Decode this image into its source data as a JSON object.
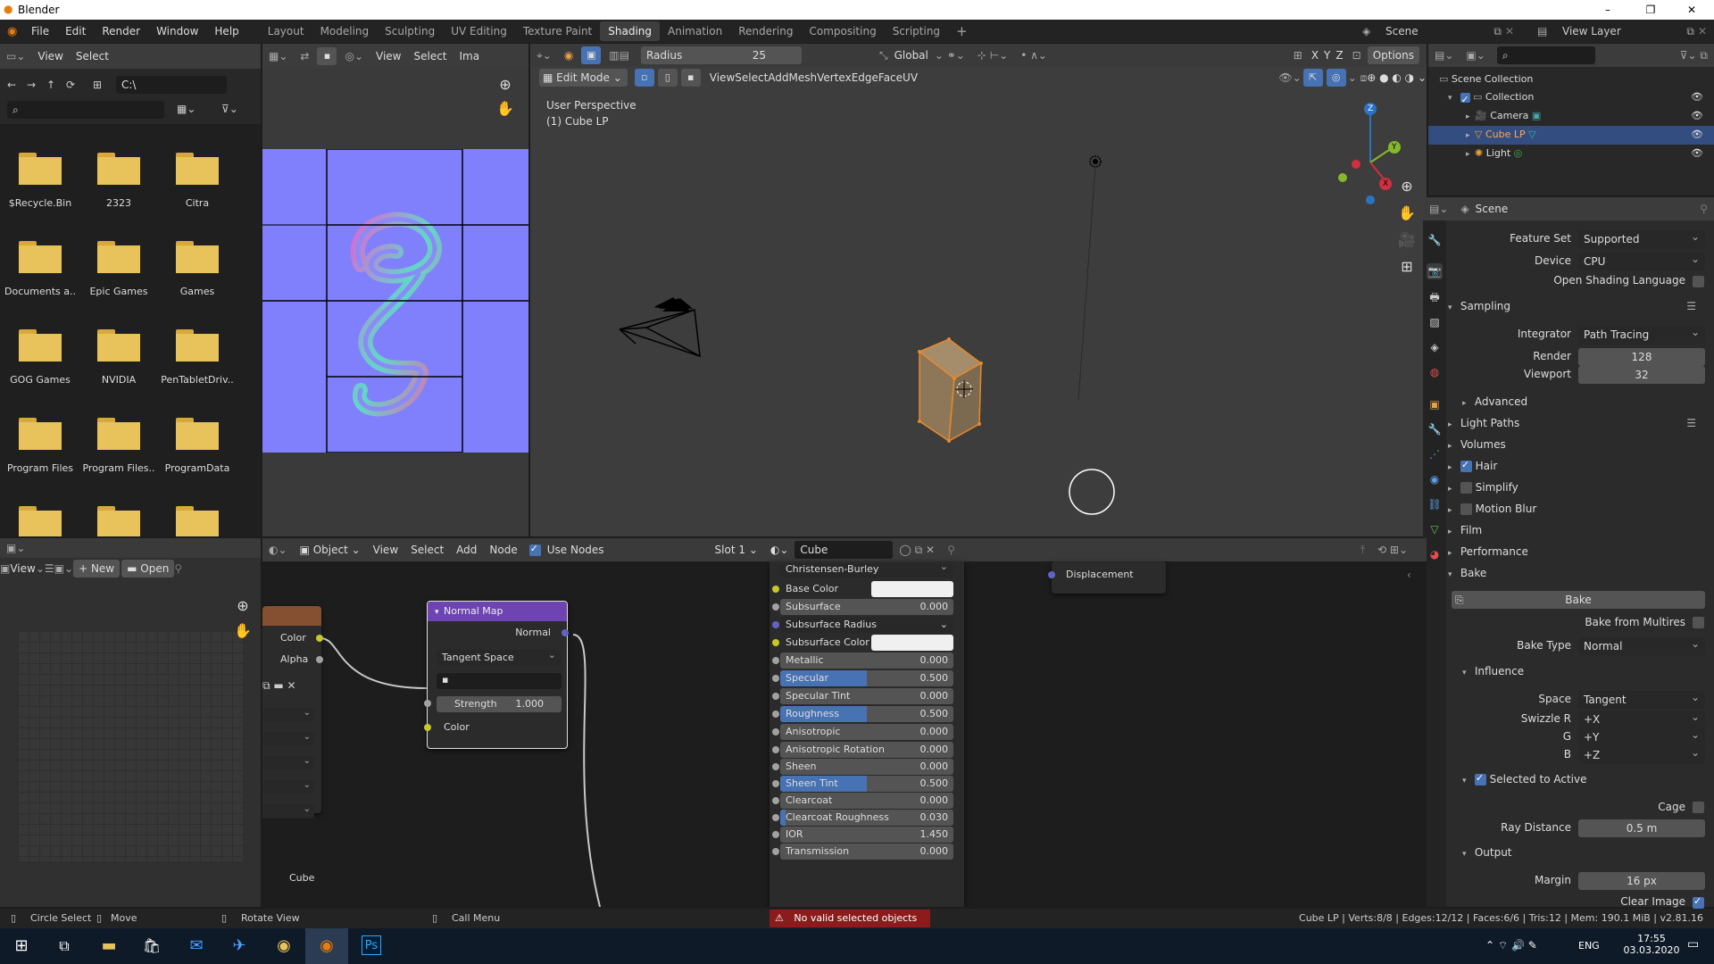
{
  "window": {
    "title": "Blender",
    "controls": {
      "minimize": "–",
      "maximize": "❐",
      "close": "✕"
    }
  },
  "menus": [
    "File",
    "Edit",
    "Render",
    "Window",
    "Help"
  ],
  "workspaces": [
    "Layout",
    "Modeling",
    "Sculpting",
    "UV Editing",
    "Texture Paint",
    "Shading",
    "Animation",
    "Rendering",
    "Compositing",
    "Scripting"
  ],
  "active_workspace": "Shading",
  "scene": {
    "label": "Scene",
    "view_layer": "View Layer"
  },
  "file_browser": {
    "menu": [
      "View",
      "Select"
    ],
    "path": "C:\\",
    "folders": [
      "$Recycle.Bin",
      "2323",
      "Citra",
      "Documents a..",
      "Epic Games",
      "Games",
      "GOG Games",
      "NVIDIA",
      "PenTabletDriv..",
      "Program Files",
      "Program Files..",
      "ProgramData"
    ]
  },
  "uv_editor": {
    "menu": [
      "View",
      "Select",
      "Ima"
    ]
  },
  "viewport": {
    "brush": {
      "label": "Radius",
      "value": "25"
    },
    "orientation": "Global",
    "axes": [
      "X",
      "Y",
      "Z"
    ],
    "options": "Options",
    "mode": "Edit Mode",
    "menu": [
      "View",
      "Select",
      "Add",
      "Mesh",
      "Vertex",
      "Edge",
      "Face",
      "UV"
    ],
    "overlay_title": "User Perspective",
    "overlay_object": "(1) Cube LP",
    "gizmo": {
      "x": "X",
      "y": "Y",
      "z": "Z"
    }
  },
  "outliner": {
    "root": "Scene Collection",
    "collection": "Collection",
    "items": [
      "Camera",
      "Cube LP",
      "Light"
    ]
  },
  "image_editor": {
    "menu": [
      "View"
    ],
    "new": "New",
    "open": "Open"
  },
  "node_editor": {
    "mode": "Object",
    "menu": [
      "View",
      "Select",
      "Add",
      "Node"
    ],
    "use_nodes": "Use Nodes",
    "slot": "Slot 1",
    "material": "Cube",
    "image_node": {
      "outputs": [
        "Color",
        "Alpha"
      ],
      "label": "Cube"
    },
    "normal_map": {
      "title": "Normal Map",
      "output": "Normal",
      "space": "Tangent Space",
      "strength_label": "Strength",
      "strength": "1.000",
      "input": "Color"
    },
    "bsdf_top": "Christensen-Burley",
    "bsdf": [
      {
        "label": "Base Color",
        "type": "color"
      },
      {
        "label": "Subsurface",
        "value": "0.000"
      },
      {
        "label": "Subsurface Radius",
        "type": "dropdown"
      },
      {
        "label": "Subsurface Color",
        "type": "color"
      },
      {
        "label": "Metallic",
        "value": "0.000"
      },
      {
        "label": "Specular",
        "value": "0.500",
        "fill": 0.5
      },
      {
        "label": "Specular Tint",
        "value": "0.000"
      },
      {
        "label": "Roughness",
        "value": "0.500",
        "fill": 0.5
      },
      {
        "label": "Anisotropic",
        "value": "0.000"
      },
      {
        "label": "Anisotropic Rotation",
        "value": "0.000"
      },
      {
        "label": "Sheen",
        "value": "0.000"
      },
      {
        "label": "Sheen Tint",
        "value": "0.500",
        "fill": 0.5
      },
      {
        "label": "Clearcoat",
        "value": "0.000"
      },
      {
        "label": "Clearcoat Roughness",
        "value": "0.030",
        "fill": 0.03
      },
      {
        "label": "IOR",
        "value": "1.450"
      },
      {
        "label": "Transmission",
        "value": "0.000"
      }
    ],
    "output_node": "Displacement"
  },
  "properties": {
    "header": "Scene",
    "feature_set": {
      "label": "Feature Set",
      "value": "Supported"
    },
    "device": {
      "label": "Device",
      "value": "CPU"
    },
    "osl": "Open Shading Language",
    "sampling": "Sampling",
    "integrator": {
      "label": "Integrator",
      "value": "Path Tracing"
    },
    "render": {
      "label": "Render",
      "value": "128"
    },
    "viewport": {
      "label": "Viewport",
      "value": "32"
    },
    "advanced": "Advanced",
    "panels": [
      "Light Paths",
      "Volumes",
      "Hair",
      "Simplify",
      "Motion Blur",
      "Film",
      "Performance"
    ],
    "bake": "Bake",
    "bake_button": "Bake",
    "bake_multires": "Bake from Multires",
    "bake_type": {
      "label": "Bake Type",
      "value": "Normal"
    },
    "influence": "Influence",
    "space": {
      "label": "Space",
      "value": "Tangent"
    },
    "swizzle_r": {
      "label": "Swizzle R",
      "value": "+X"
    },
    "swizzle_g": {
      "label": "G",
      "value": "+Y"
    },
    "swizzle_b": {
      "label": "B",
      "value": "+Z"
    },
    "selected_to_active": "Selected to Active",
    "cage": "Cage",
    "ray_distance": {
      "label": "Ray Distance",
      "value": "0.5 m"
    },
    "output": "Output",
    "margin": {
      "label": "Margin",
      "value": "16 px"
    },
    "clear_image": "Clear Image"
  },
  "statusbar": {
    "items": [
      "Circle Select",
      "Move",
      "Rotate View",
      "Call Menu"
    ],
    "error": "No valid selected objects",
    "stats": "Cube LP | Verts:8/8 | Edges:12/12 | Faces:6/6 | Tris:12 | Mem: 190.1 MiB | v2.81.16"
  },
  "taskbar": {
    "lang": "ENG",
    "time": "17:55",
    "date": "03.03.2020"
  }
}
